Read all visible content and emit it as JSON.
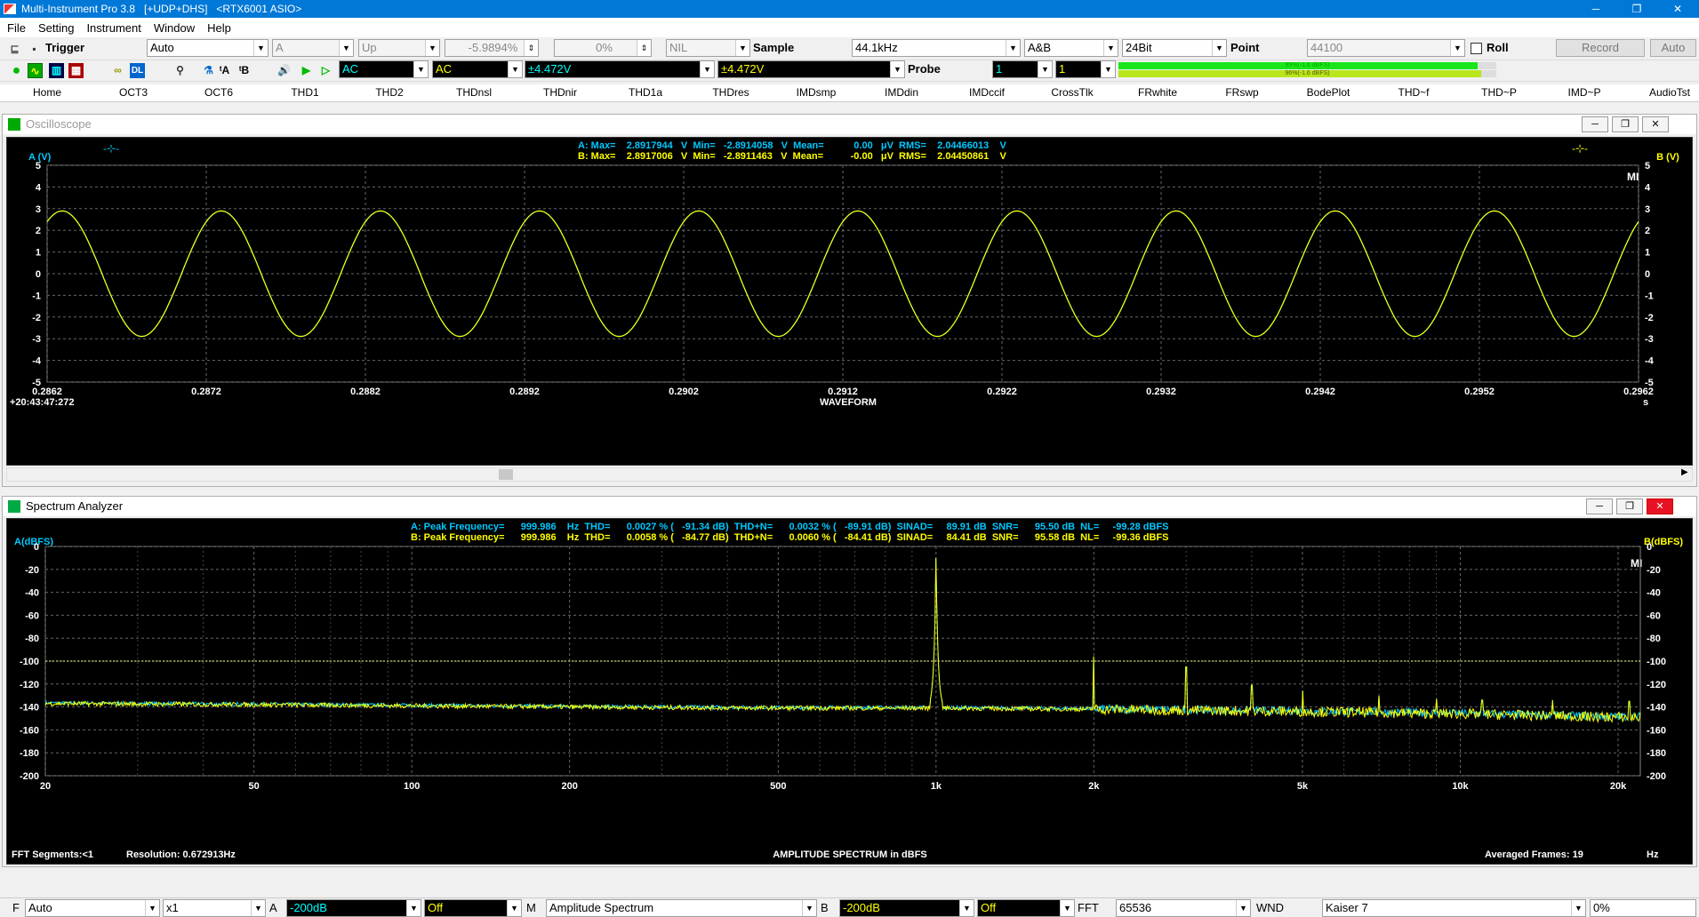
{
  "app": {
    "title": "Multi-Instrument Pro 3.8   [+UDP+DHS]   <RTX6001 ASIO>",
    "min": "─",
    "max": "❐",
    "close": "✕"
  },
  "menu": [
    "File",
    "Setting",
    "Instrument",
    "Window",
    "Help"
  ],
  "toolbar1": {
    "trigger_label": "Trigger",
    "trigger_mode": "Auto",
    "trigger_source": "A",
    "trigger_edge": "Up",
    "trigger_level": "-5.9894%",
    "trigger_delay": "0%",
    "nil": "NIL",
    "sample_label": "Sample",
    "sample_rate": "44.1kHz",
    "channels": "A&B",
    "bits": "24Bit",
    "point_label": "Point",
    "points": "44100",
    "roll_label": "Roll",
    "record_label": "Record",
    "auto_label": "Auto"
  },
  "toolbar2": {
    "coupling_a": "AC",
    "coupling_b": "AC",
    "range_a": "±4.472V",
    "range_b": "±4.472V",
    "probe_label": "Probe",
    "probe_a": "1",
    "probe_b": "1",
    "level_a": "95%(-1.6 dBFS)",
    "level_b": "96%(-1.6 dBFS)"
  },
  "tabs": [
    "Home",
    "OCT3",
    "OCT6",
    "THD1",
    "THD2",
    "THDnsl",
    "THDnir",
    "THD1a",
    "THDres",
    "IMDsmp",
    "IMDdin",
    "IMDccif",
    "CrossTlk",
    "FRwhite",
    "FRswp",
    "BodePlot",
    "THD~f",
    "THD~P",
    "IMD~P",
    "AudioTst"
  ],
  "osc": {
    "title": "Oscilloscope",
    "stats_a": "A: Max=    2.8917944   V  Min=   -2.8914058   V  Mean=           0.00   μV  RMS=    2.04466013    V",
    "stats_b": "B: Max=    2.8917006   V  Min=   -2.8911463   V  Mean=          -0.00   μV  RMS=    2.04450861    V",
    "ylabel_a": "A (V)",
    "ylabel_b": "B (V)",
    "xlabel": "WAVEFORM",
    "timestamp": "+20:43:47:272",
    "unit": "s",
    "mi": "MI",
    "y_ticks": [
      "5",
      "4",
      "3",
      "2",
      "1",
      "0",
      "-1",
      "-2",
      "-3",
      "-4",
      "-5"
    ],
    "x_ticks": [
      "0.2862",
      "0.2872",
      "0.2882",
      "0.2892",
      "0.2902",
      "0.2912",
      "0.2922",
      "0.2932",
      "0.2942",
      "0.2952",
      "0.2962"
    ]
  },
  "spec": {
    "title": "Spectrum Analyzer",
    "stats_a": "A: Peak Frequency=      999.986    Hz  THD=      0.0027 % (   -91.34 dB)  THD+N=      0.0032 % (   -89.91 dB)  SINAD=     89.91 dB  SNR=      95.50 dB  NL=     -99.28 dBFS",
    "stats_b": "B: Peak Frequency=      999.986    Hz  THD=      0.0058 % (   -84.77 dB)  THD+N=      0.0060 % (   -84.41 dB)  SINAD=     84.41 dB  SNR=      95.58 dB  NL=     -99.36 dBFS",
    "ylabel_a": "A(dBFS)",
    "ylabel_b": "B(dBFS)",
    "xlabel": "AMPLITUDE SPECTRUM in dBFS",
    "fft_segments": "FFT Segments:<1",
    "resolution": "Resolution: 0.672913Hz",
    "averaged": "Averaged Frames: 19",
    "unit": "Hz",
    "mi": "MI",
    "y_ticks": [
      "0",
      "-20",
      "-40",
      "-60",
      "-80",
      "-100",
      "-120",
      "-140",
      "-160",
      "-180",
      "-200"
    ],
    "x_ticks": [
      "20",
      "50",
      "100",
      "200",
      "500",
      "1k",
      "2k",
      "5k",
      "10k",
      "20k"
    ]
  },
  "bottom": {
    "f_label": "F",
    "f_mode": "Auto",
    "mult": "x1",
    "a_label": "A",
    "a_floor": "-200dB",
    "a_off": "Off",
    "m_label": "M",
    "m_mode": "Amplitude Spectrum",
    "b_label": "B",
    "b_floor": "-200dB",
    "b_off": "Off",
    "fft_label": "FFT",
    "fft_size": "65536",
    "wnd_label": "WND",
    "window": "Kaiser 7",
    "overlap": "0%"
  },
  "colors": {
    "trace_a": "#00c8ff",
    "trace_b": "#ffff00",
    "grid": "#666666",
    "title_bar": "#0078d7"
  },
  "chart_data": [
    {
      "type": "line",
      "title": "WAVEFORM",
      "xlabel": "s",
      "ylabel": "A (V)",
      "xlim": [
        0.2862,
        0.2962
      ],
      "ylim": [
        -5,
        5
      ],
      "grid": true,
      "series": [
        {
          "name": "A",
          "signal": "sine",
          "frequency_hz": 1000,
          "amplitude_v": 2.8918,
          "phase_deg": 56
        },
        {
          "name": "B",
          "signal": "sine",
          "frequency_hz": 1000,
          "amplitude_v": 2.8917,
          "phase_deg": 56
        }
      ]
    },
    {
      "type": "line",
      "title": "AMPLITUDE SPECTRUM in dBFS",
      "xlabel": "Hz",
      "ylabel": "A(dBFS)",
      "xscale": "log",
      "xlim": [
        20,
        22050
      ],
      "ylim": [
        -200,
        0
      ],
      "grid": true,
      "reference_line_db": -100,
      "noise_floor": [
        {
          "hz": 20,
          "db": -137
        },
        {
          "hz": 50,
          "db": -138
        },
        {
          "hz": 100,
          "db": -139
        },
        {
          "hz": 200,
          "db": -140
        },
        {
          "hz": 500,
          "db": -141
        },
        {
          "hz": 1000,
          "db": -141
        },
        {
          "hz": 2000,
          "db": -142
        },
        {
          "hz": 5000,
          "db": -144
        },
        {
          "hz": 10000,
          "db": -146
        },
        {
          "hz": 20000,
          "db": -149
        }
      ],
      "peaks": [
        {
          "hz": 1000,
          "db": -10
        },
        {
          "hz": 2000,
          "db": -96
        },
        {
          "hz": 3000,
          "db": -105
        },
        {
          "hz": 4000,
          "db": -121
        },
        {
          "hz": 5000,
          "db": -126
        },
        {
          "hz": 7000,
          "db": -130
        },
        {
          "hz": 9000,
          "db": -133
        },
        {
          "hz": 11000,
          "db": -134
        },
        {
          "hz": 15000,
          "db": -134
        },
        {
          "hz": 21000,
          "db": -135
        }
      ]
    }
  ]
}
